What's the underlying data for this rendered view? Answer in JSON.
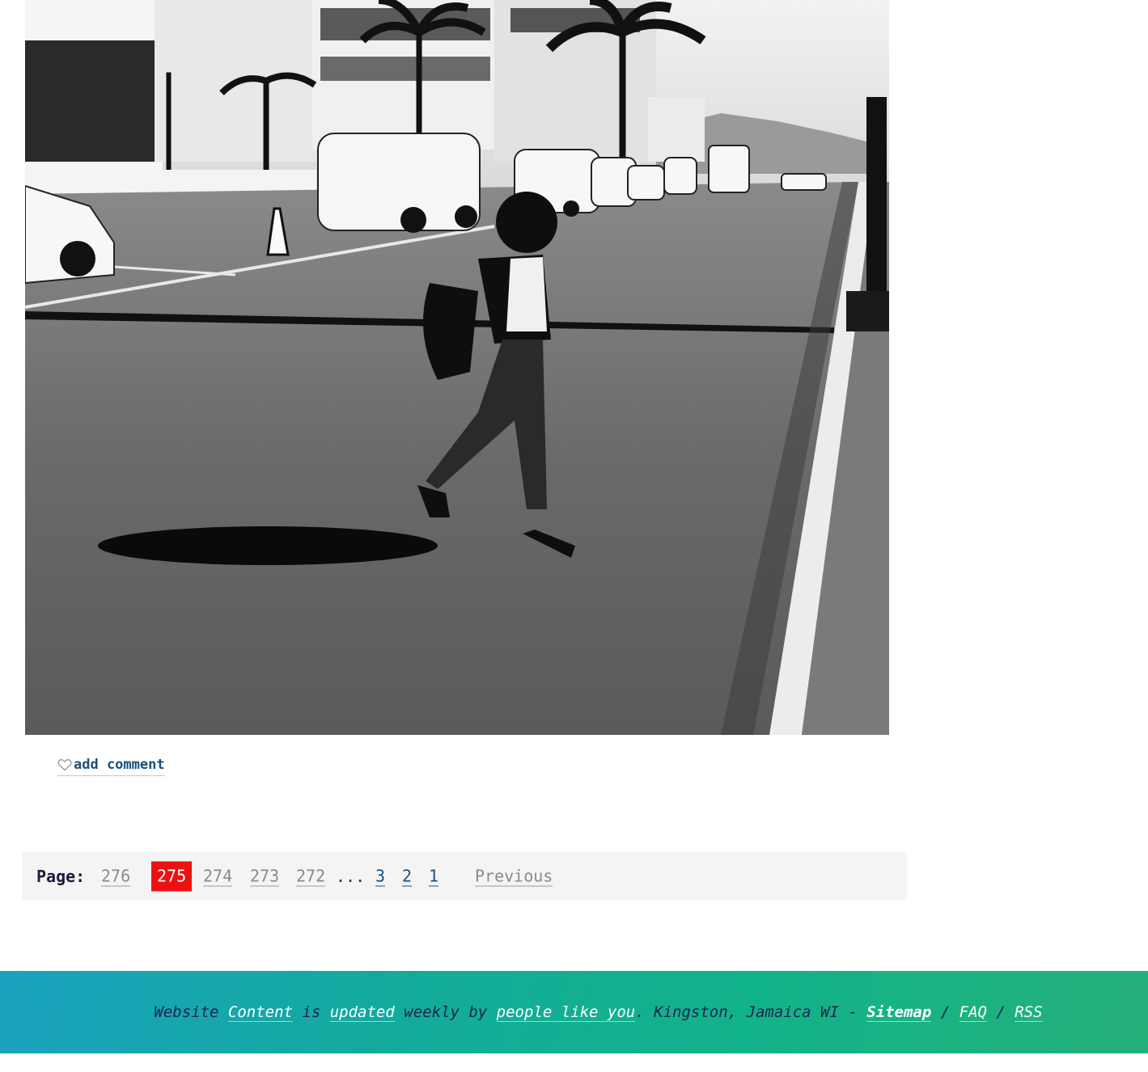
{
  "post": {
    "comment_label": "add comment"
  },
  "pagination": {
    "label": "Page:",
    "pages": [
      "276",
      "275",
      "274",
      "273",
      "272",
      "...",
      "3",
      "2",
      "1"
    ],
    "current": "275",
    "previous_label": "Previous"
  },
  "footer": {
    "t1": "Website ",
    "content_link": "Content",
    "t2": " is ",
    "updated_link": "updated",
    "t3": " weekly by ",
    "people_link": "people like you",
    "t4": ". Kingston, Jamaica WI - ",
    "sitemap_link": "Sitemap",
    "sep1": " / ",
    "faq_link": "FAQ",
    "sep2": " / ",
    "rss_link": "RSS"
  },
  "colors": {
    "current_page_bg": "#ee1111",
    "link_blue": "#1a4f7a",
    "footer_gradient_start": "#1aa1bf",
    "footer_gradient_end": "#25b07a"
  },
  "icons": {
    "comment": "heart-icon"
  }
}
